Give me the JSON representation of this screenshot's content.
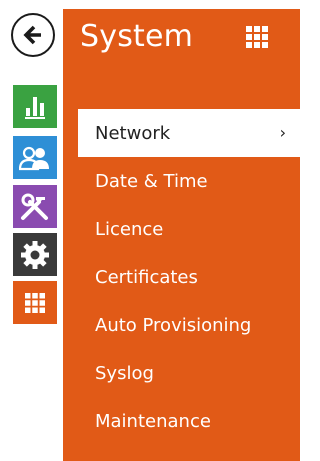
{
  "panel": {
    "title": "System",
    "accent_color": "#e15a17",
    "grid_icon": "grid-icon"
  },
  "rail": {
    "back_icon": "arrow-left-icon",
    "items": [
      {
        "icon": "bar-chart-icon",
        "color": "#3aa241"
      },
      {
        "icon": "users-icon",
        "color": "#2e8fd6"
      },
      {
        "icon": "tools-icon",
        "color": "#8a4bb0"
      },
      {
        "icon": "gear-icon",
        "color": "#3a3a3a"
      },
      {
        "icon": "grid-icon",
        "color": "#e15a17"
      }
    ]
  },
  "menu": {
    "items": [
      {
        "label": "Network",
        "active": true,
        "chevron": "›"
      },
      {
        "label": "Date & Time"
      },
      {
        "label": "Licence"
      },
      {
        "label": "Certificates"
      },
      {
        "label": "Auto Provisioning"
      },
      {
        "label": "Syslog"
      },
      {
        "label": "Maintenance"
      }
    ]
  }
}
